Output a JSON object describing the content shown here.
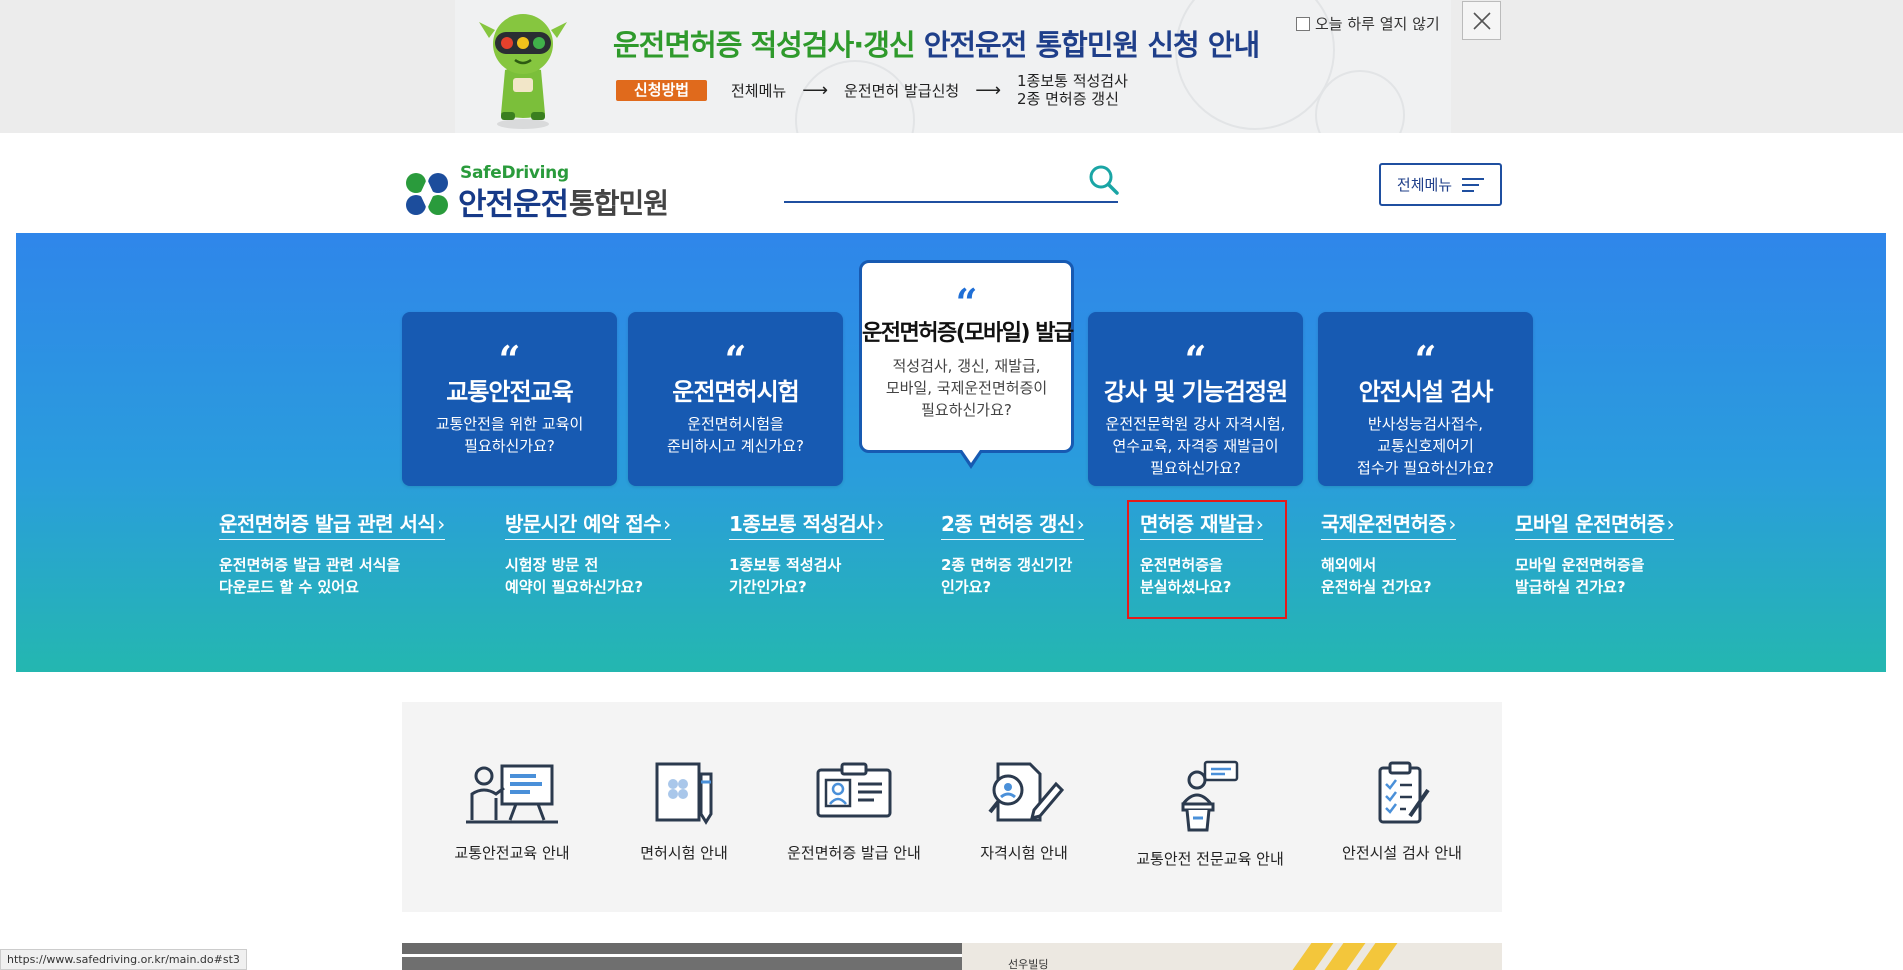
{
  "banner": {
    "title_part1": "운전면허증 적성검사·갱신",
    "title_part2": " 안전운전 통합민원 신청 안내",
    "badge": "신청방법",
    "step1": "전체메뉴",
    "step2": "운전면허 발급신청",
    "step3_line1": "1종보통 적성검사",
    "step3_line2": "2종 면허증 갱신",
    "arrow": "⟶",
    "no_show_today": "오늘 하루 열지 않기",
    "colors": {
      "title_green": "#2f9a2c",
      "title_navy": "#1f3f8a",
      "badge": "#e06a1c"
    }
  },
  "header": {
    "logo_en": "SafeDriving",
    "logo_ko1": "안전운전",
    "logo_ko2": "통합민원",
    "search_placeholder": "",
    "all_menu": "전체메뉴"
  },
  "hero": {
    "cards": [
      {
        "title": "교통안전교육",
        "desc": "교통안전을 위한 교육이\n필요하신가요?"
      },
      {
        "title": "운전면허시험",
        "desc": "운전면허시험을\n준비하시고 계신가요?"
      },
      {
        "title": "운전면허증(모바일) 발급",
        "desc": "적성검사, 갱신, 재발급,\n모바일, 국제운전면허증이\n필요하신가요?"
      },
      {
        "title": "강사 및 기능검정원",
        "desc": "운전전문학원 강사 자격시험,\n연수교육, 자격증 재발급이\n필요하신가요?"
      },
      {
        "title": "안전시설 검사",
        "desc": "반사성능검사접수,\n교통신호제어기\n접수가 필요하신가요?"
      }
    ],
    "quote": "“",
    "links": [
      {
        "title": "운전면허증 발급 관련 서식",
        "desc": "운전면허증 발급 관련 서식을\n다운로드 할 수 있어요"
      },
      {
        "title": "방문시간 예약 접수",
        "desc": "시험장 방문 전\n예약이 필요하신가요?"
      },
      {
        "title": "1종보통 적성검사",
        "desc": "1종보통 적성검사\n기간인가요?"
      },
      {
        "title": "2종 면허증 갱신",
        "desc": "2종 면허증 갱신기간\n인가요?"
      },
      {
        "title": "면허증 재발급",
        "desc": "운전면허증을\n분실하셨나요?"
      },
      {
        "title": "국제운전면허증",
        "desc": "해외에서\n운전하실 건가요?"
      },
      {
        "title": "모바일 운전면허증",
        "desc": "모바일 운전면허증을\n발급하실 건가요?"
      }
    ],
    "chevron": "›",
    "colors": {
      "card": "#175ab2",
      "gradient_top": "#2f86ea",
      "gradient_bottom": "#24b7b0",
      "highlight": "#e51a1a"
    }
  },
  "guides": [
    {
      "label": "교통안전교육 안내",
      "icon": "teacher-board-icon"
    },
    {
      "label": "면허시험 안내",
      "icon": "document-pen-icon"
    },
    {
      "label": "운전면허증 발급 안내",
      "icon": "id-card-icon"
    },
    {
      "label": "자격시험 안내",
      "icon": "exam-magnifier-icon"
    },
    {
      "label": "교통안전 전문교육 안내",
      "icon": "lecturer-podium-icon"
    },
    {
      "label": "안전시설 검사 안내",
      "icon": "clipboard-checklist-icon"
    }
  ],
  "map": {
    "label1": "선우빌딩"
  },
  "status_url": "https://www.safedriving.or.kr/main.do#st3"
}
